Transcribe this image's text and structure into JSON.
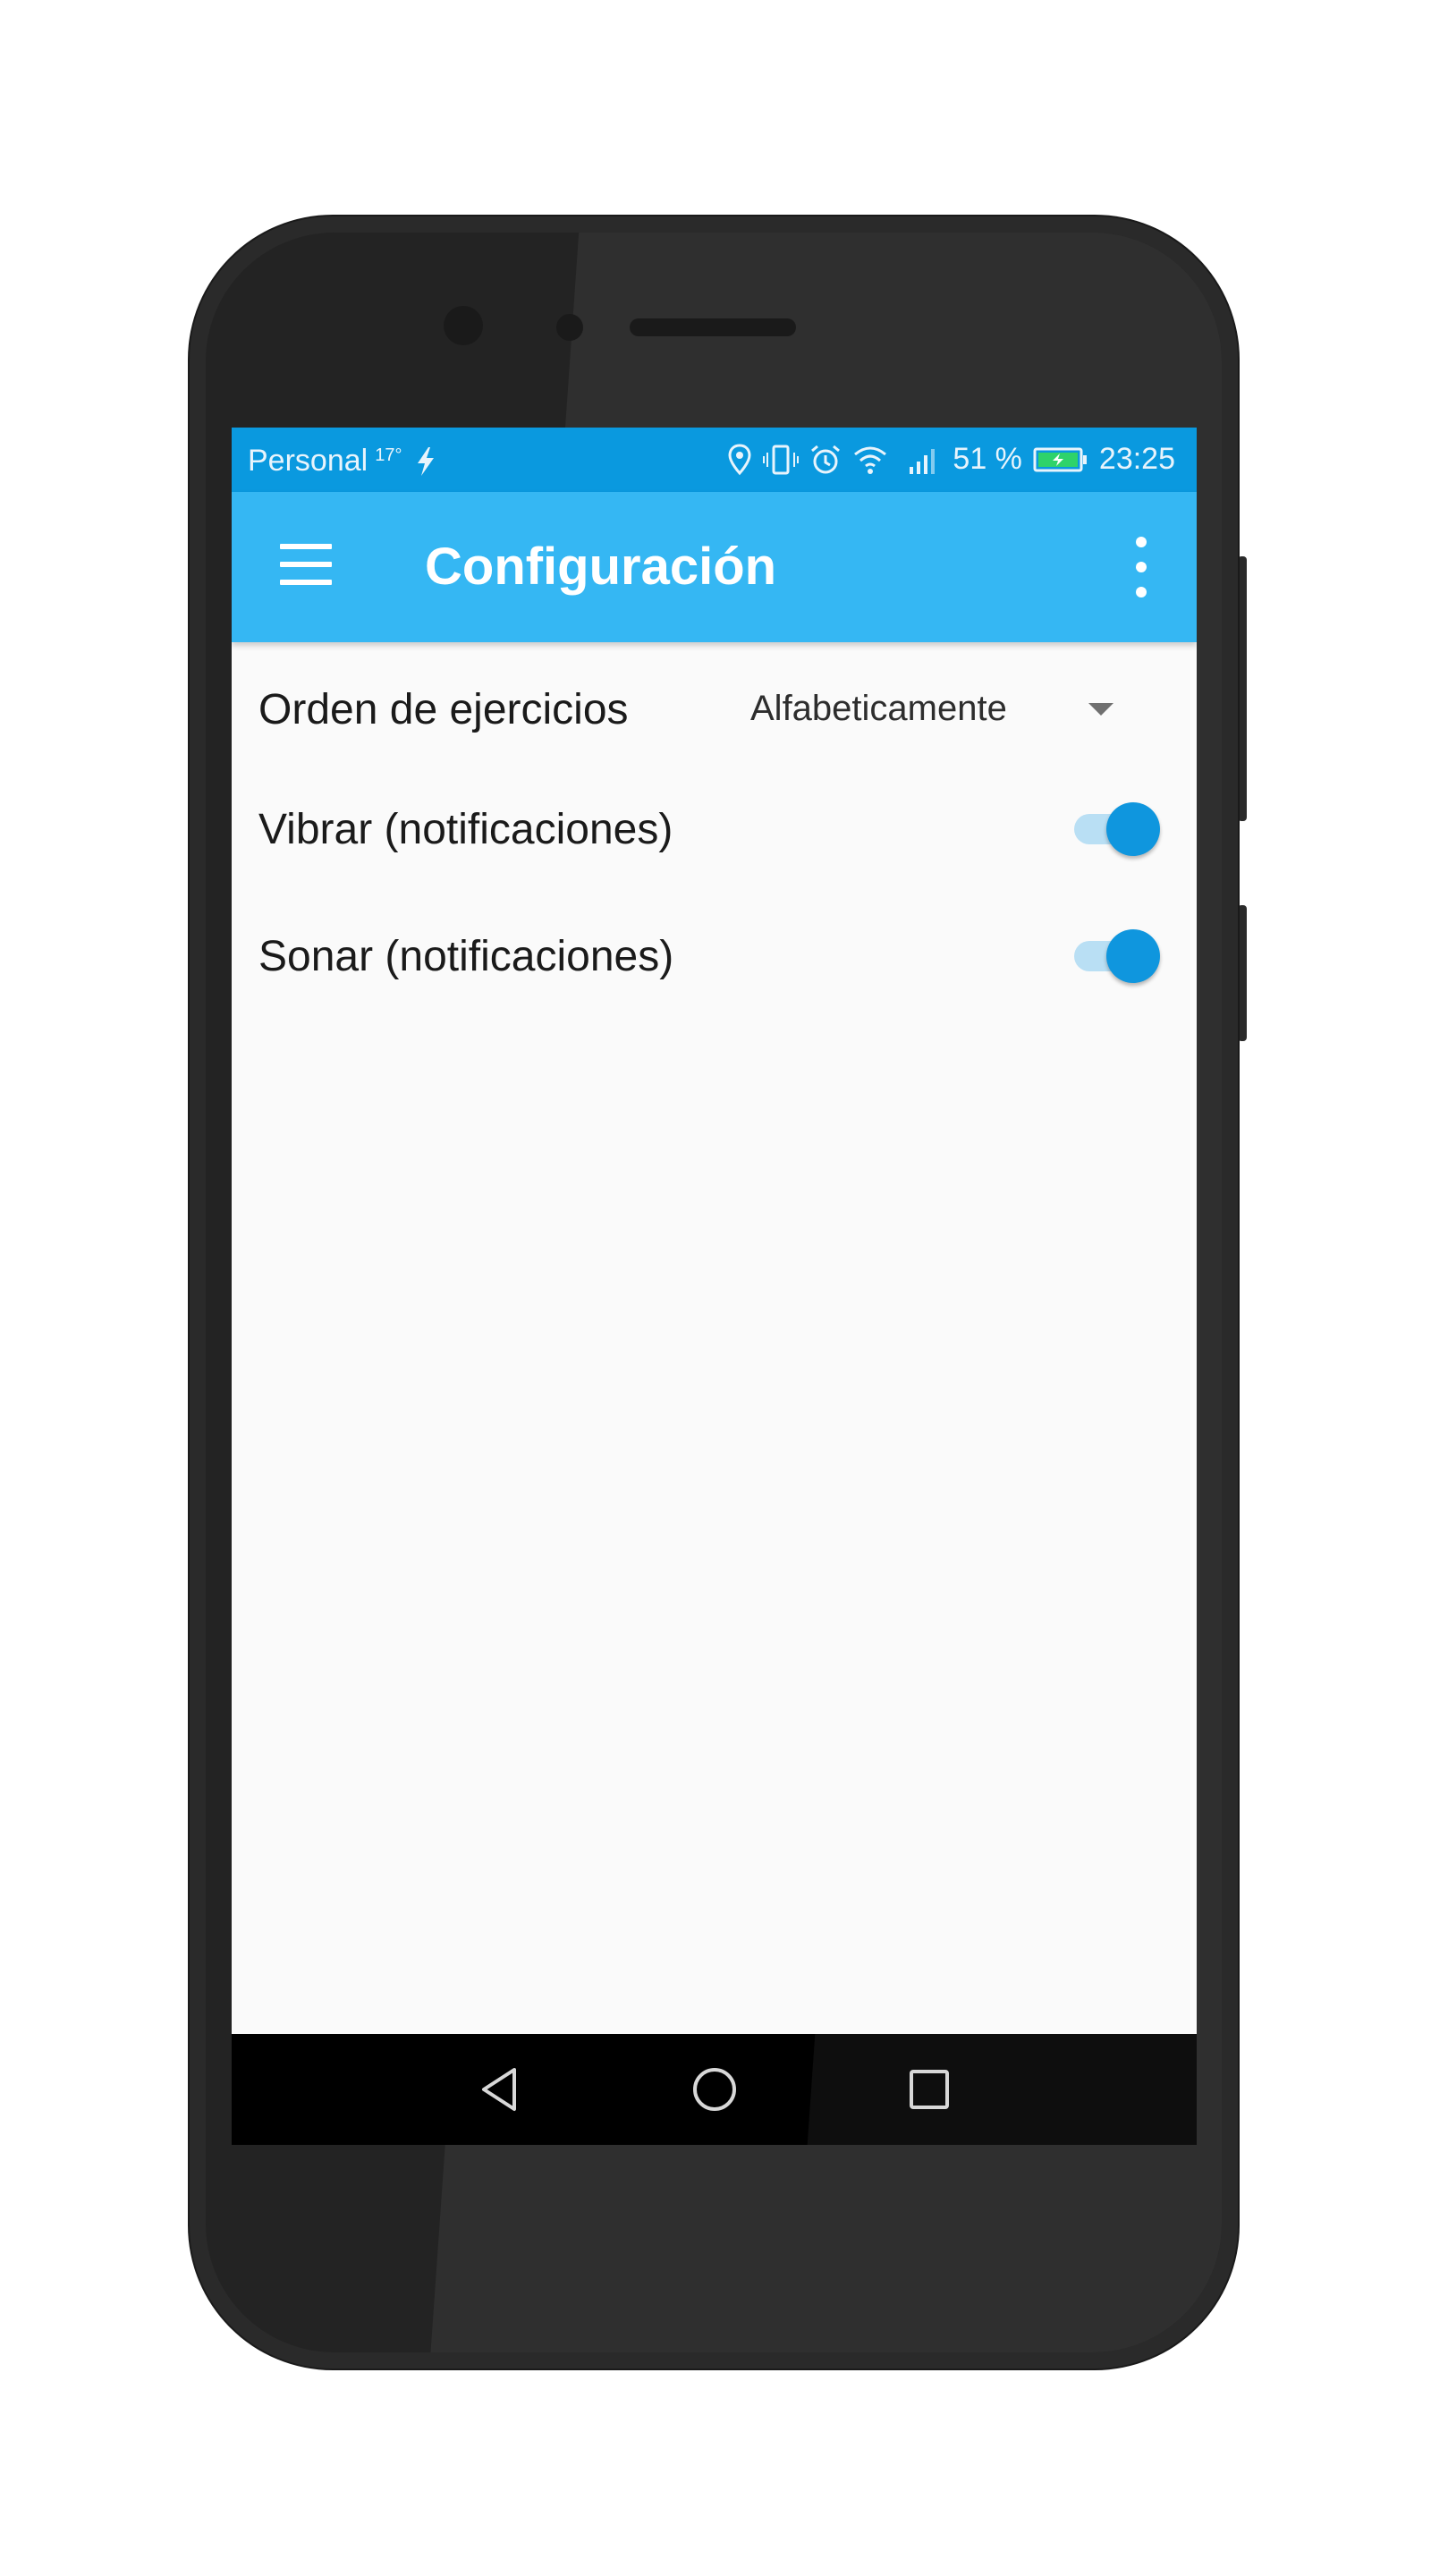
{
  "status_bar": {
    "carrier": "Personal",
    "temperature": "17°",
    "battery_percent": "51 %",
    "time": "23:25",
    "icons": [
      "bolt-icon",
      "location-icon",
      "vibrate-icon",
      "alarm-icon",
      "wifi-icon",
      "signal-icon",
      "battery-charging-icon"
    ]
  },
  "app_bar": {
    "title": "Configuración",
    "menu_icon": "hamburger-menu-icon",
    "overflow_icon": "more-vert-icon",
    "color": "#35b7f3"
  },
  "settings": {
    "order": {
      "label": "Orden de ejercicios",
      "selected": "Alfabeticamente"
    },
    "vibrate": {
      "label": "Vibrar (notificaciones)",
      "enabled": true
    },
    "sound": {
      "label": "Sonar (notificaciones)",
      "enabled": true
    }
  },
  "nav_bar": {
    "back": "back-triangle-icon",
    "home": "home-circle-icon",
    "recents": "recents-square-icon"
  },
  "colors": {
    "status_bar": "#0a99df",
    "accent": "#0f96de",
    "switch_track": "#b9dff4"
  }
}
